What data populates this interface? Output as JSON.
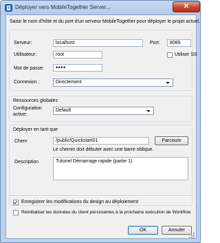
{
  "window": {
    "title": "Déployer vers MobileTogether Server..."
  },
  "intro": "Saisir le nom d'hôte et du port d'un serveur MobileTogether pour déployer le projet actuel.",
  "server": {
    "serveur_label": "Serveur:",
    "serveur_value": "localhost",
    "port_label": "Port:",
    "port_value": "8085",
    "user_label": "Utilisateur:",
    "user_value": "root",
    "use_ss_label": "Utiliser SS",
    "password_label": "Mot de passe:",
    "password_value": "••••",
    "connexion_label": "Connexion :",
    "connexion_value": "Directement"
  },
  "resources": {
    "heading": "Ressources globales",
    "config_label_1": "Configuration",
    "config_label_2": "active:",
    "config_value": "Default"
  },
  "deploy": {
    "heading": "Déployer en tant que",
    "chem_label": "Chem",
    "chem_value": "/public/Quickstart01",
    "browse_label": "Parcourir",
    "hint": "Le chemin doit débuter avec une barre oblique.",
    "description_label": "Description",
    "description_value": "Tutoriel Démarrage rapide (partie 1)"
  },
  "options": {
    "save_design_label": "Enregistrer les modifications du design au déploiement",
    "save_design_checked": true,
    "reset_label": "Réinitialiser les données du client persistantes à la prochaine exécution de Workflow",
    "reset_checked": false
  },
  "buttons": {
    "ok": "OK",
    "cancel": "Annuler"
  }
}
